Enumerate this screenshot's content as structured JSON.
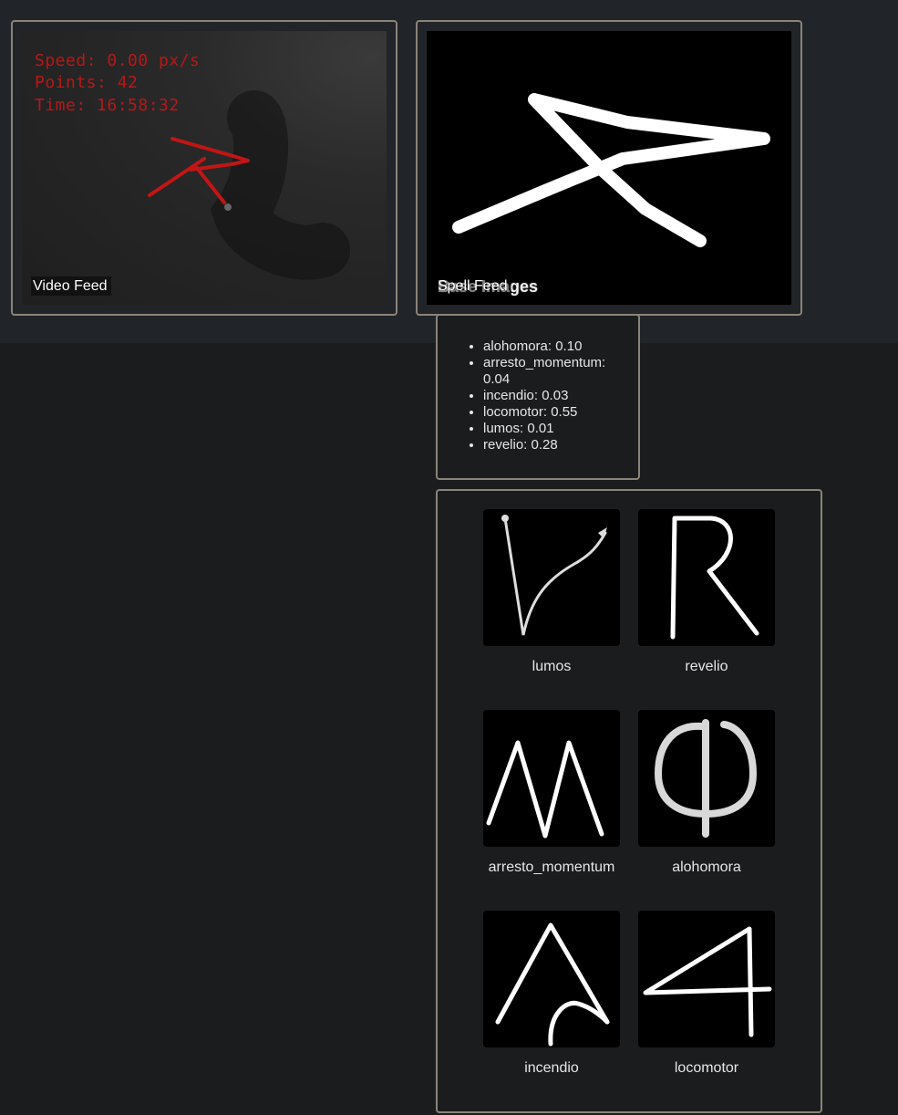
{
  "video_feed": {
    "label": "Video Feed",
    "overlay": {
      "speed": "Speed: 0.00 px/s",
      "points": "Points: 42",
      "time": "Time: 16:58:32"
    }
  },
  "spell_feed": {
    "label": "Spell Feed",
    "base_images_title": "Base Images"
  },
  "results": [
    "alohomora: 0.10",
    "arresto_momentum: 0.04",
    "incendio: 0.03",
    "locomotor: 0.55",
    "lumos: 0.01",
    "revelio: 0.28"
  ],
  "base_images": [
    {
      "name": "lumos"
    },
    {
      "name": "revelio"
    },
    {
      "name": "arresto_momentum"
    },
    {
      "name": "alohomora"
    },
    {
      "name": "incendio"
    },
    {
      "name": "locomotor"
    }
  ],
  "colors": {
    "page_background": "#1b1c1e",
    "top_band": "#212428",
    "panel_border": "#8a8478",
    "overlay_text": "#b81818",
    "stroke": "#ffffff"
  }
}
